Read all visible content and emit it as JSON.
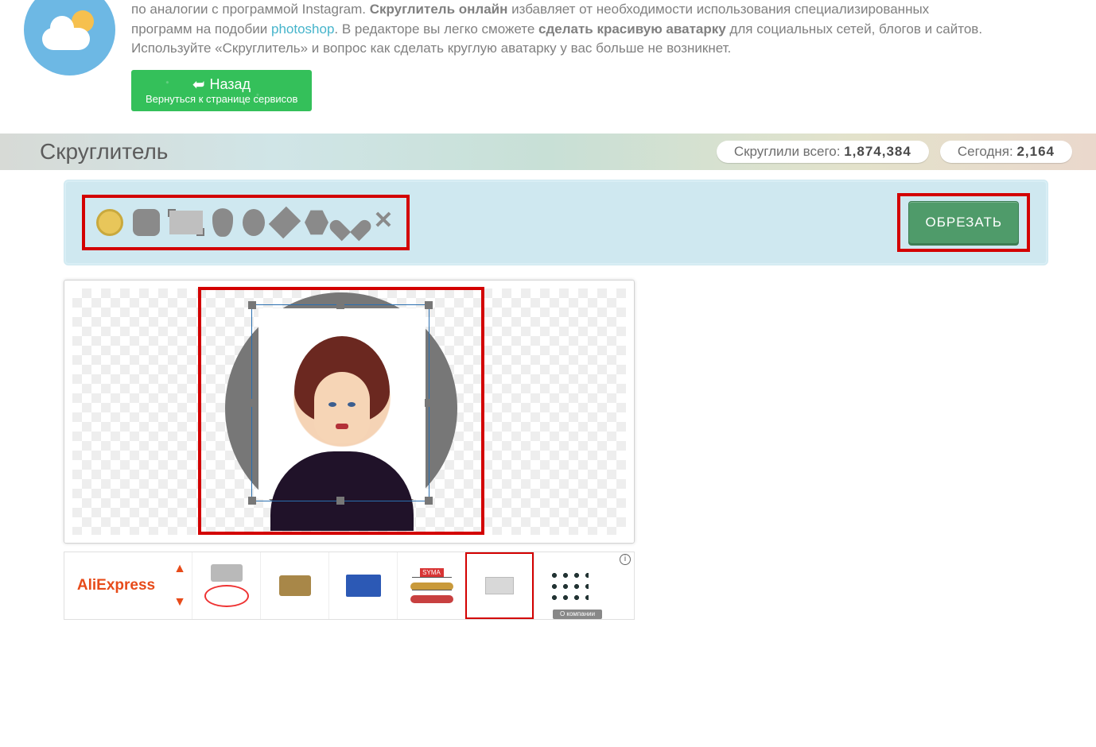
{
  "intro": {
    "line1_pre": "по аналогии с программой Instagram. ",
    "line1_bold": "Скруглитель онлайн",
    "line1_post": " избавляет от необходимости использования специализированных программ на подобии ",
    "photoshop": "photoshop",
    "line2_pre": ". В редакторе вы легко сможете ",
    "line2_bold": "сделать красивую аватарку",
    "line2_post": " для социальных сетей, блогов и  сайтов. Используйте «Скруглитель» и вопрос как сделать круглую аватарку у вас больше не возникнет."
  },
  "back_button": {
    "title": "Назад",
    "subtitle": "Вернуться к странице сервисов"
  },
  "heading": "Скруглитель",
  "stats": {
    "total_label": "Скруглили всего: ",
    "total_value": "1,874,384",
    "today_label": "Сегодня: ",
    "today_value": "2,164"
  },
  "shapes": [
    "circle",
    "rounded-square",
    "rectangle",
    "drop",
    "oval",
    "diamond",
    "hexagon",
    "heart",
    "cross"
  ],
  "crop_label": "ОБРЕЗАТЬ",
  "ad": {
    "brand": "AliExpress",
    "badge": "О компании",
    "info": "i"
  }
}
